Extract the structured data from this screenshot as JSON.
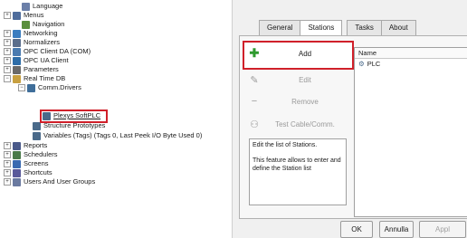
{
  "tree": {
    "items": [
      {
        "label": "Language",
        "expander": "",
        "icon_color": "#6b7fa8"
      },
      {
        "label": "Menus",
        "expander": "+",
        "icon_color": "#4f6d9c"
      },
      {
        "label": "Navigation",
        "expander": "",
        "icon_color": "#5a8f3c"
      },
      {
        "label": "Networking",
        "expander": "+",
        "icon_color": "#3b7dbf"
      },
      {
        "label": "Normalizers",
        "expander": "+",
        "icon_color": "#5a6e8c"
      },
      {
        "label": "OPC Client DA (COM)",
        "expander": "+",
        "icon_color": "#4a7bb0"
      },
      {
        "label": "OPC UA Client",
        "expander": "+",
        "icon_color": "#2e6da8"
      },
      {
        "label": "Parameters",
        "expander": "+",
        "icon_color": "#6a6a6a"
      },
      {
        "label": "Real Time DB",
        "expander": "−",
        "icon_color": "#c8a040"
      },
      {
        "label": "Comm.Drivers",
        "expander": "−",
        "icon_color": "#3f6e9a"
      },
      {
        "label": "Plexys SoftPLC",
        "expander": "",
        "icon_color": "#4a6a8a"
      },
      {
        "label": "Structure Prototypes",
        "expander": "",
        "icon_color": "#4a6a8a"
      },
      {
        "label": "Variables (Tags) (Tags 0, Last Peek I/O Byte Used 0)",
        "expander": "",
        "icon_color": "#4a6a8a"
      },
      {
        "label": "Reports",
        "expander": "+",
        "icon_color": "#4a5a8a"
      },
      {
        "label": "Schedulers",
        "expander": "+",
        "icon_color": "#4a7a4a"
      },
      {
        "label": "Screens",
        "expander": "+",
        "icon_color": "#3a6ab0"
      },
      {
        "label": "Shortcuts",
        "expander": "+",
        "icon_color": "#5a5a9a"
      },
      {
        "label": "Users And User Groups",
        "expander": "+",
        "icon_color": "#6a7aa0"
      }
    ]
  },
  "tabs": [
    {
      "label": "General",
      "active": false
    },
    {
      "label": "Stations",
      "active": true
    },
    {
      "label": "Tasks",
      "active": false
    },
    {
      "label": "About",
      "active": false
    }
  ],
  "commands": {
    "add": "Add",
    "edit": "Edit",
    "remove": "Remove",
    "test": "Test Cable/Comm."
  },
  "list": {
    "header": "Name",
    "items": [
      "PLC"
    ]
  },
  "description": {
    "line1": "Edit the list of Stations.",
    "line2": "This feature allows to enter and define the Station list"
  },
  "buttons": {
    "ok": "OK",
    "cancel": "Annulla",
    "apply": "Appl"
  },
  "colors": {
    "highlight": "#d0202a",
    "add_icon": "#2e9a2e"
  }
}
